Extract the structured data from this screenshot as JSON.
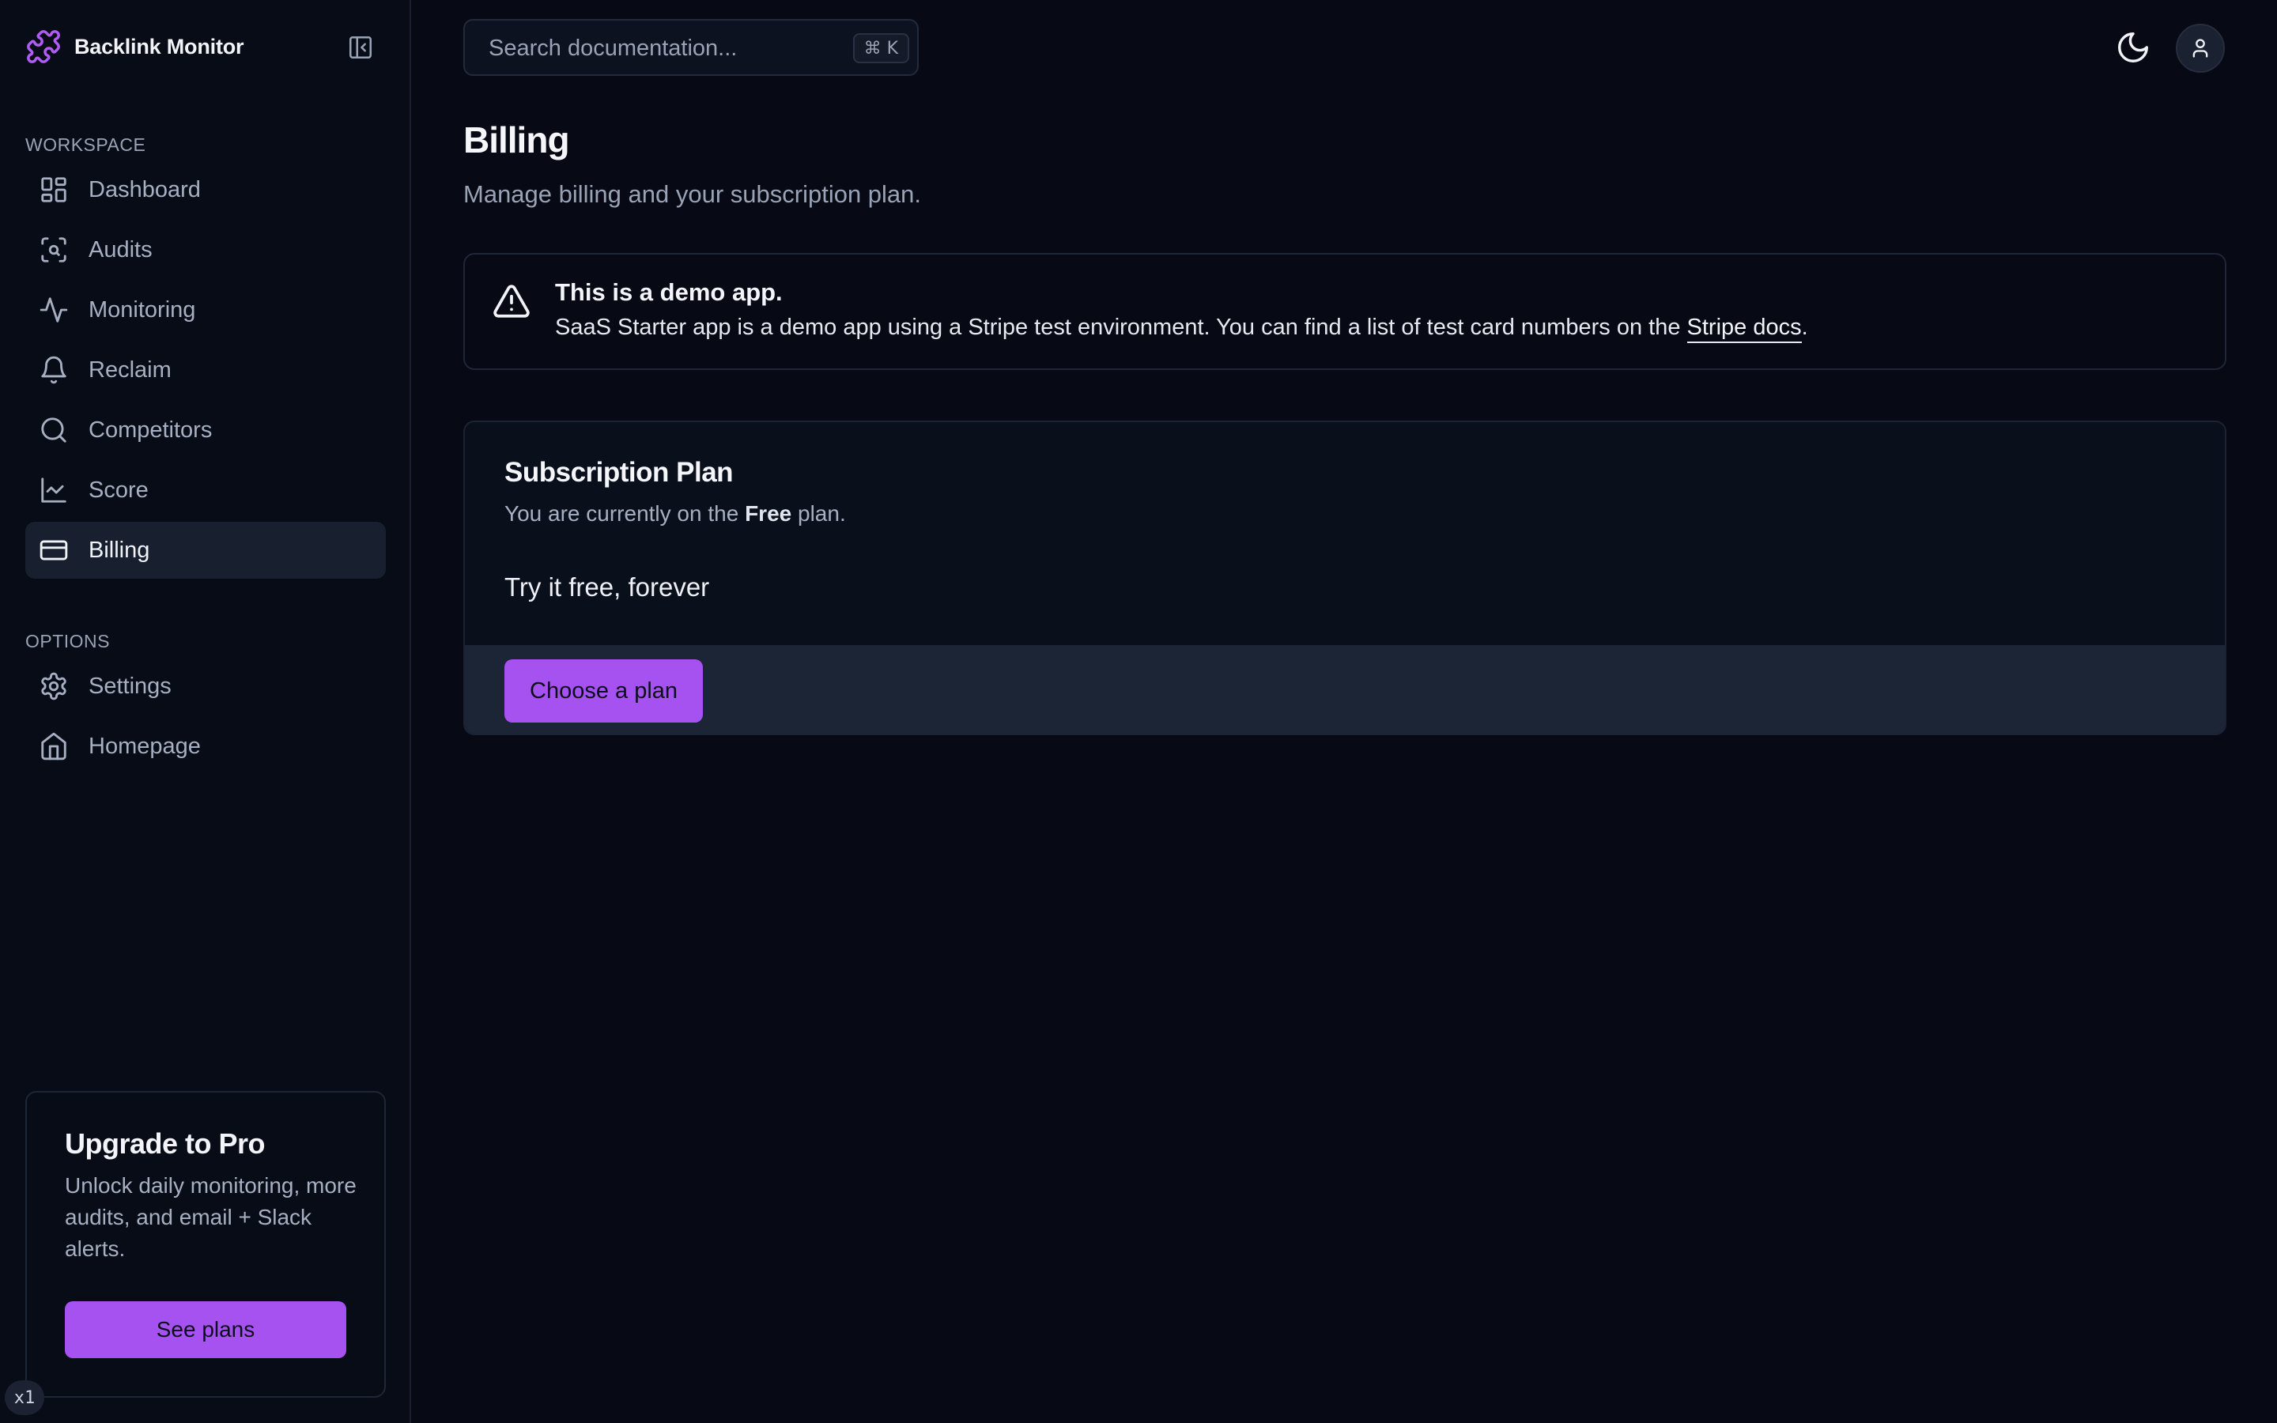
{
  "app": {
    "name": "Backlink Monitor"
  },
  "sidebar": {
    "workspace_label": "WORKSPACE",
    "options_label": "OPTIONS",
    "workspace_items": [
      {
        "label": "Dashboard",
        "icon": "dashboard-icon"
      },
      {
        "label": "Audits",
        "icon": "scan-icon"
      },
      {
        "label": "Monitoring",
        "icon": "activity-icon"
      },
      {
        "label": "Reclaim",
        "icon": "bell-icon"
      },
      {
        "label": "Competitors",
        "icon": "search-icon"
      },
      {
        "label": "Score",
        "icon": "chart-icon"
      },
      {
        "label": "Billing",
        "icon": "credit-card-icon",
        "active": true
      }
    ],
    "option_items": [
      {
        "label": "Settings",
        "icon": "gear-icon"
      },
      {
        "label": "Homepage",
        "icon": "home-icon"
      }
    ],
    "upgrade": {
      "title": "Upgrade to Pro",
      "description": "Unlock daily monitoring, more audits, and email + Slack alerts.",
      "button": "See plans"
    },
    "version_badge": "x1"
  },
  "topbar": {
    "search_placeholder": "Search documentation...",
    "shortcut": "⌘ K"
  },
  "page": {
    "title": "Billing",
    "subtitle": "Manage billing and your subscription plan."
  },
  "alert": {
    "title": "This is a demo app.",
    "text": "SaaS Starter app is a demo app using a Stripe test environment. You can find a list of test card numbers on the",
    "link": "Stripe docs",
    "suffix": "."
  },
  "plan": {
    "title": "Subscription Plan",
    "desc_prefix": "You are currently on the",
    "plan_name": "Free",
    "desc_suffix": "plan.",
    "tagline": "Try it free, forever",
    "button": "Choose a plan"
  },
  "colors": {
    "accent": "#a552f0",
    "background": "#070a14",
    "active_nav": "#18202f"
  }
}
